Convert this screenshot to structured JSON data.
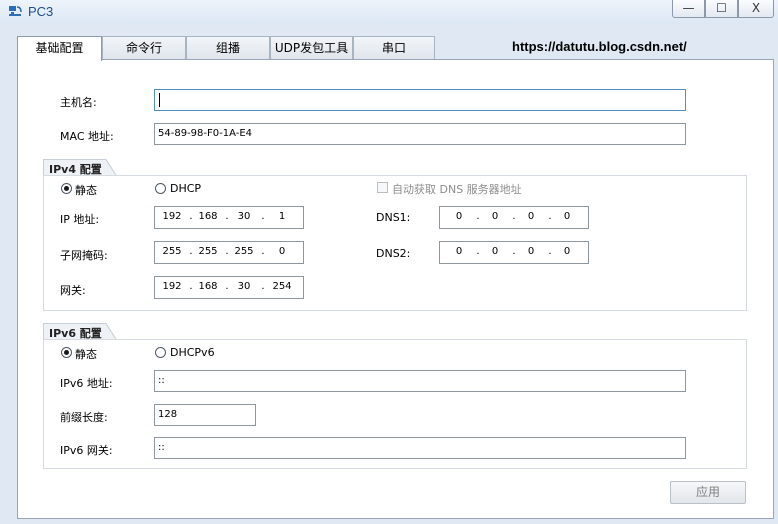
{
  "window": {
    "title": "PC3",
    "min": "—",
    "max": "☐",
    "close": "X"
  },
  "tabs": [
    "基础配置",
    "命令行",
    "组播",
    "UDP发包工具",
    "串口"
  ],
  "watermark": "https://datutu.blog.csdn.net/",
  "basic": {
    "hostname_label": "主机名:",
    "hostname_value": "",
    "mac_label": "MAC 地址:",
    "mac_value": "54-89-98-F0-1A-E4"
  },
  "ipv4": {
    "group_title": "IPv4 配置",
    "static_label": "静态",
    "dhcp_label": "DHCP",
    "auto_dns_label": "自动获取 DNS 服务器地址",
    "ip_label": "IP 地址:",
    "ip": [
      "192",
      "168",
      "30",
      "1"
    ],
    "mask_label": "子网掩码:",
    "mask": [
      "255",
      "255",
      "255",
      "0"
    ],
    "gateway_label": "网关:",
    "gateway": [
      "192",
      "168",
      "30",
      "254"
    ],
    "dns1_label": "DNS1:",
    "dns1": [
      "0",
      "0",
      "0",
      "0"
    ],
    "dns2_label": "DNS2:",
    "dns2": [
      "0",
      "0",
      "0",
      "0"
    ],
    "mode": "static"
  },
  "ipv6": {
    "group_title": "IPv6 配置",
    "static_label": "静态",
    "dhcp_label": "DHCPv6",
    "addr_label": "IPv6 地址:",
    "addr_value": "::",
    "prefix_label": "前缀长度:",
    "prefix_value": "128",
    "gateway_label": "IPv6 网关:",
    "gateway_value": "::",
    "mode": "static"
  },
  "apply_label": "应用",
  "dot": "."
}
